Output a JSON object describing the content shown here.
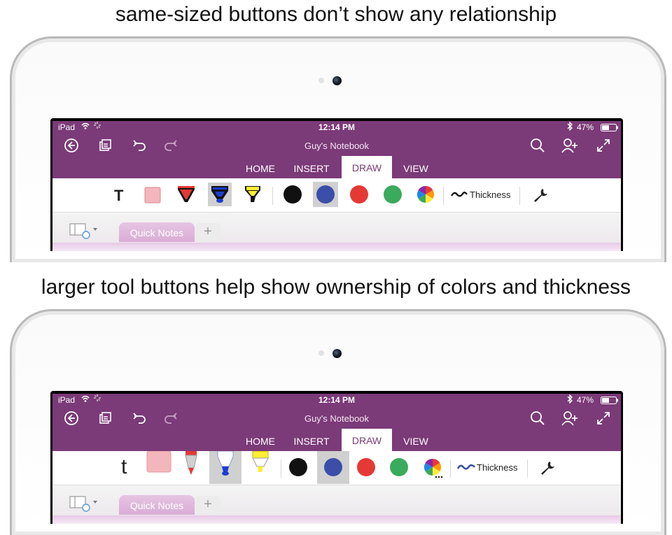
{
  "captions": {
    "top": "same-sized buttons don’t show any relationship",
    "bottom": "larger tool buttons help show ownership of colors and thickness"
  },
  "app": {
    "status_left": "iPad",
    "time": "12:14 PM",
    "battery": "47%",
    "notebook_title": "Guy's Notebook",
    "tabs": [
      "HOME",
      "INSERT",
      "DRAW",
      "VIEW"
    ],
    "active_tab": "DRAW",
    "thickness_label": "Thickness",
    "section_tab": "Quick Notes",
    "add_section": "+",
    "text_tool_top": "T",
    "text_tool_bottom": "t"
  },
  "colors": {
    "purple": "#7b3a78",
    "black": "#111111",
    "blue": "#3b4fa8",
    "red": "#e53935",
    "green": "#3aaa5c"
  }
}
